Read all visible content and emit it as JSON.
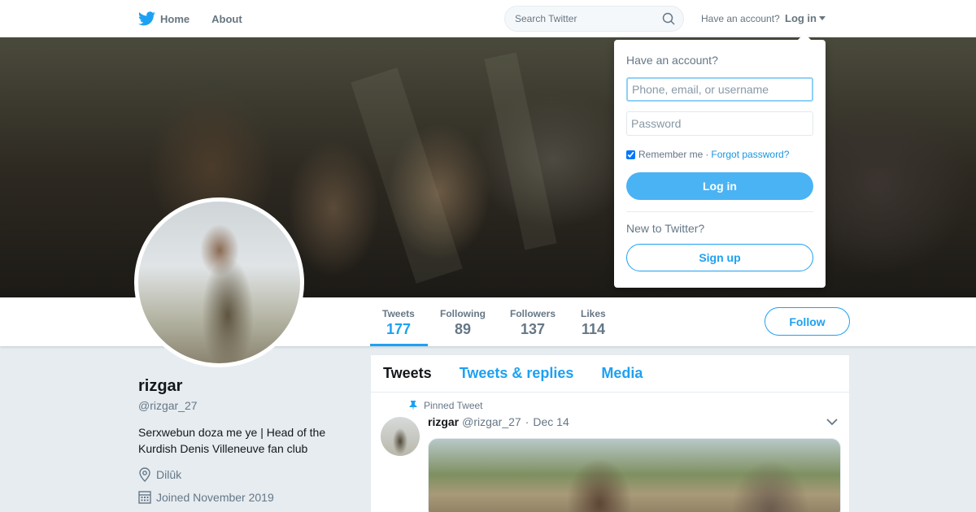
{
  "topnav": {
    "home_label": "Home",
    "about_label": "About",
    "search_placeholder": "Search Twitter",
    "have_account": "Have an account?",
    "login_label": "Log in"
  },
  "login_dropdown": {
    "title": "Have an account?",
    "username_placeholder": "Phone, email, or username",
    "password_placeholder": "Password",
    "remember_label": "Remember me",
    "separator": "·",
    "forgot_label": "Forgot password?",
    "login_button": "Log in",
    "new_label": "New to Twitter?",
    "signup_button": "Sign up"
  },
  "profile_nav": {
    "stats": [
      {
        "label": "Tweets",
        "value": "177"
      },
      {
        "label": "Following",
        "value": "89"
      },
      {
        "label": "Followers",
        "value": "137"
      },
      {
        "label": "Likes",
        "value": "114"
      }
    ],
    "follow_button": "Follow"
  },
  "profile": {
    "name": "rizgar",
    "handle": "@rizgar_27",
    "bio": "Serxwebun doza me ye | Head of the Kurdish Denis Villeneuve fan club",
    "location": "Dilûk",
    "joined": "Joined November 2019"
  },
  "timeline": {
    "tabs": [
      "Tweets",
      "Tweets & replies",
      "Media"
    ],
    "pinned_label": "Pinned Tweet",
    "tweet": {
      "name": "rizgar",
      "handle": "@rizgar_27",
      "dot": "·",
      "date": "Dec 14"
    }
  },
  "colors": {
    "accent": "#1da1f2",
    "login_button": "#4ab3f4",
    "muted": "#657786",
    "page_bg": "#e6ecf0"
  }
}
